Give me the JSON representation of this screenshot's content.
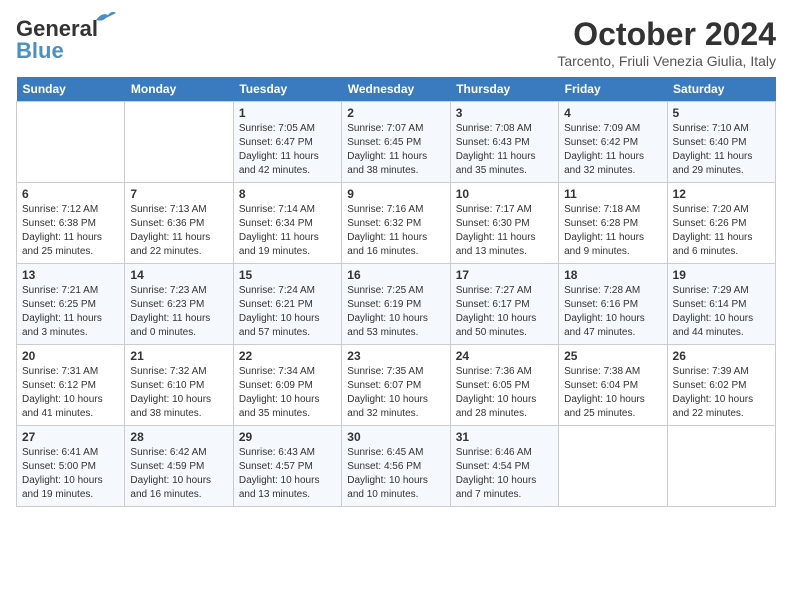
{
  "logo": {
    "line1": "General",
    "line2": "Blue"
  },
  "title": "October 2024",
  "location": "Tarcento, Friuli Venezia Giulia, Italy",
  "weekdays": [
    "Sunday",
    "Monday",
    "Tuesday",
    "Wednesday",
    "Thursday",
    "Friday",
    "Saturday"
  ],
  "weeks": [
    [
      {
        "day": "",
        "sunrise": "",
        "sunset": "",
        "daylight": ""
      },
      {
        "day": "",
        "sunrise": "",
        "sunset": "",
        "daylight": ""
      },
      {
        "day": "1",
        "sunrise": "Sunrise: 7:05 AM",
        "sunset": "Sunset: 6:47 PM",
        "daylight": "Daylight: 11 hours and 42 minutes."
      },
      {
        "day": "2",
        "sunrise": "Sunrise: 7:07 AM",
        "sunset": "Sunset: 6:45 PM",
        "daylight": "Daylight: 11 hours and 38 minutes."
      },
      {
        "day": "3",
        "sunrise": "Sunrise: 7:08 AM",
        "sunset": "Sunset: 6:43 PM",
        "daylight": "Daylight: 11 hours and 35 minutes."
      },
      {
        "day": "4",
        "sunrise": "Sunrise: 7:09 AM",
        "sunset": "Sunset: 6:42 PM",
        "daylight": "Daylight: 11 hours and 32 minutes."
      },
      {
        "day": "5",
        "sunrise": "Sunrise: 7:10 AM",
        "sunset": "Sunset: 6:40 PM",
        "daylight": "Daylight: 11 hours and 29 minutes."
      }
    ],
    [
      {
        "day": "6",
        "sunrise": "Sunrise: 7:12 AM",
        "sunset": "Sunset: 6:38 PM",
        "daylight": "Daylight: 11 hours and 25 minutes."
      },
      {
        "day": "7",
        "sunrise": "Sunrise: 7:13 AM",
        "sunset": "Sunset: 6:36 PM",
        "daylight": "Daylight: 11 hours and 22 minutes."
      },
      {
        "day": "8",
        "sunrise": "Sunrise: 7:14 AM",
        "sunset": "Sunset: 6:34 PM",
        "daylight": "Daylight: 11 hours and 19 minutes."
      },
      {
        "day": "9",
        "sunrise": "Sunrise: 7:16 AM",
        "sunset": "Sunset: 6:32 PM",
        "daylight": "Daylight: 11 hours and 16 minutes."
      },
      {
        "day": "10",
        "sunrise": "Sunrise: 7:17 AM",
        "sunset": "Sunset: 6:30 PM",
        "daylight": "Daylight: 11 hours and 13 minutes."
      },
      {
        "day": "11",
        "sunrise": "Sunrise: 7:18 AM",
        "sunset": "Sunset: 6:28 PM",
        "daylight": "Daylight: 11 hours and 9 minutes."
      },
      {
        "day": "12",
        "sunrise": "Sunrise: 7:20 AM",
        "sunset": "Sunset: 6:26 PM",
        "daylight": "Daylight: 11 hours and 6 minutes."
      }
    ],
    [
      {
        "day": "13",
        "sunrise": "Sunrise: 7:21 AM",
        "sunset": "Sunset: 6:25 PM",
        "daylight": "Daylight: 11 hours and 3 minutes."
      },
      {
        "day": "14",
        "sunrise": "Sunrise: 7:23 AM",
        "sunset": "Sunset: 6:23 PM",
        "daylight": "Daylight: 11 hours and 0 minutes."
      },
      {
        "day": "15",
        "sunrise": "Sunrise: 7:24 AM",
        "sunset": "Sunset: 6:21 PM",
        "daylight": "Daylight: 10 hours and 57 minutes."
      },
      {
        "day": "16",
        "sunrise": "Sunrise: 7:25 AM",
        "sunset": "Sunset: 6:19 PM",
        "daylight": "Daylight: 10 hours and 53 minutes."
      },
      {
        "day": "17",
        "sunrise": "Sunrise: 7:27 AM",
        "sunset": "Sunset: 6:17 PM",
        "daylight": "Daylight: 10 hours and 50 minutes."
      },
      {
        "day": "18",
        "sunrise": "Sunrise: 7:28 AM",
        "sunset": "Sunset: 6:16 PM",
        "daylight": "Daylight: 10 hours and 47 minutes."
      },
      {
        "day": "19",
        "sunrise": "Sunrise: 7:29 AM",
        "sunset": "Sunset: 6:14 PM",
        "daylight": "Daylight: 10 hours and 44 minutes."
      }
    ],
    [
      {
        "day": "20",
        "sunrise": "Sunrise: 7:31 AM",
        "sunset": "Sunset: 6:12 PM",
        "daylight": "Daylight: 10 hours and 41 minutes."
      },
      {
        "day": "21",
        "sunrise": "Sunrise: 7:32 AM",
        "sunset": "Sunset: 6:10 PM",
        "daylight": "Daylight: 10 hours and 38 minutes."
      },
      {
        "day": "22",
        "sunrise": "Sunrise: 7:34 AM",
        "sunset": "Sunset: 6:09 PM",
        "daylight": "Daylight: 10 hours and 35 minutes."
      },
      {
        "day": "23",
        "sunrise": "Sunrise: 7:35 AM",
        "sunset": "Sunset: 6:07 PM",
        "daylight": "Daylight: 10 hours and 32 minutes."
      },
      {
        "day": "24",
        "sunrise": "Sunrise: 7:36 AM",
        "sunset": "Sunset: 6:05 PM",
        "daylight": "Daylight: 10 hours and 28 minutes."
      },
      {
        "day": "25",
        "sunrise": "Sunrise: 7:38 AM",
        "sunset": "Sunset: 6:04 PM",
        "daylight": "Daylight: 10 hours and 25 minutes."
      },
      {
        "day": "26",
        "sunrise": "Sunrise: 7:39 AM",
        "sunset": "Sunset: 6:02 PM",
        "daylight": "Daylight: 10 hours and 22 minutes."
      }
    ],
    [
      {
        "day": "27",
        "sunrise": "Sunrise: 6:41 AM",
        "sunset": "Sunset: 5:00 PM",
        "daylight": "Daylight: 10 hours and 19 minutes."
      },
      {
        "day": "28",
        "sunrise": "Sunrise: 6:42 AM",
        "sunset": "Sunset: 4:59 PM",
        "daylight": "Daylight: 10 hours and 16 minutes."
      },
      {
        "day": "29",
        "sunrise": "Sunrise: 6:43 AM",
        "sunset": "Sunset: 4:57 PM",
        "daylight": "Daylight: 10 hours and 13 minutes."
      },
      {
        "day": "30",
        "sunrise": "Sunrise: 6:45 AM",
        "sunset": "Sunset: 4:56 PM",
        "daylight": "Daylight: 10 hours and 10 minutes."
      },
      {
        "day": "31",
        "sunrise": "Sunrise: 6:46 AM",
        "sunset": "Sunset: 4:54 PM",
        "daylight": "Daylight: 10 hours and 7 minutes."
      },
      {
        "day": "",
        "sunrise": "",
        "sunset": "",
        "daylight": ""
      },
      {
        "day": "",
        "sunrise": "",
        "sunset": "",
        "daylight": ""
      }
    ]
  ]
}
